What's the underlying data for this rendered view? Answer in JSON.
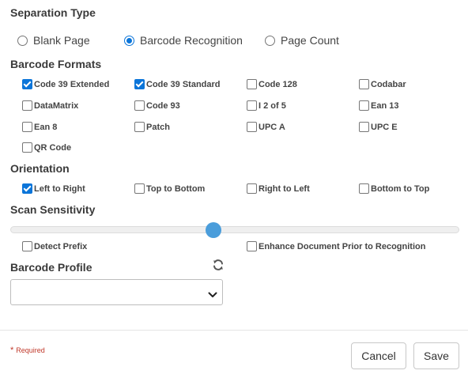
{
  "separation": {
    "title": "Separation Type",
    "options": [
      {
        "label": "Blank Page",
        "selected": false
      },
      {
        "label": "Barcode Recognition",
        "selected": true
      },
      {
        "label": "Page Count",
        "selected": false
      }
    ]
  },
  "formats": {
    "title": "Barcode Formats",
    "items": [
      {
        "label": "Code 39 Extended",
        "checked": true
      },
      {
        "label": "Code 39 Standard",
        "checked": true
      },
      {
        "label": "Code 128",
        "checked": false
      },
      {
        "label": "Codabar",
        "checked": false
      },
      {
        "label": "DataMatrix",
        "checked": false
      },
      {
        "label": "Code 93",
        "checked": false
      },
      {
        "label": "I 2 of 5",
        "checked": false
      },
      {
        "label": "Ean 13",
        "checked": false
      },
      {
        "label": "Ean 8",
        "checked": false
      },
      {
        "label": "Patch",
        "checked": false
      },
      {
        "label": "UPC A",
        "checked": false
      },
      {
        "label": "UPC E",
        "checked": false
      },
      {
        "label": "QR Code",
        "checked": false
      }
    ]
  },
  "orientation": {
    "title": "Orientation",
    "items": [
      {
        "label": "Left to Right",
        "checked": true
      },
      {
        "label": "Top to Bottom",
        "checked": false
      },
      {
        "label": "Right to Left",
        "checked": false
      },
      {
        "label": "Bottom to Top",
        "checked": false
      }
    ]
  },
  "sensitivity": {
    "title": "Scan Sensitivity",
    "value_fraction": 0.45,
    "options": [
      {
        "label": "Detect Prefix",
        "checked": false
      },
      {
        "label": "Enhance Document Prior to Recognition",
        "checked": false
      }
    ]
  },
  "profile": {
    "title": "Barcode Profile",
    "refresh_icon": "refresh-icon",
    "selected": ""
  },
  "footer": {
    "required_marker": "*",
    "required_label": "Required",
    "cancel_label": "Cancel",
    "save_label": "Save"
  },
  "colors": {
    "accent": "#0b75d9",
    "slider_thumb": "#4a9ddb",
    "required": "#c0392b"
  }
}
